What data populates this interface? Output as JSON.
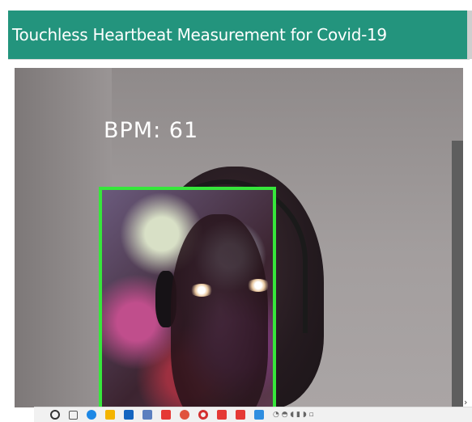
{
  "header": {
    "title": "Touchless Heartbeat Measurement for Covid-19",
    "background_color": "#23947d"
  },
  "video": {
    "overlay_text": "BPM: 61",
    "face_box_color": "#36e63b"
  },
  "taskbar": {
    "icons": [
      {
        "name": "search-icon",
        "color": "#333333"
      },
      {
        "name": "task-view-icon",
        "color": "#555555"
      },
      {
        "name": "edge-icon",
        "color": "#1e88e5"
      },
      {
        "name": "file-explorer-icon",
        "color": "#f4b400"
      },
      {
        "name": "store-icon",
        "color": "#1565c0"
      },
      {
        "name": "app-icon",
        "color": "#5b7fbf"
      },
      {
        "name": "app-red-icon",
        "color": "#e53935"
      },
      {
        "name": "chrome-icon",
        "color": "#e0533d"
      },
      {
        "name": "opera-icon",
        "color": "#d32f2f"
      },
      {
        "name": "app-red2-icon",
        "color": "#e53935"
      },
      {
        "name": "app-red3-icon",
        "color": "#e53935"
      },
      {
        "name": "vscode-icon",
        "color": "#2f8ee0"
      }
    ]
  }
}
